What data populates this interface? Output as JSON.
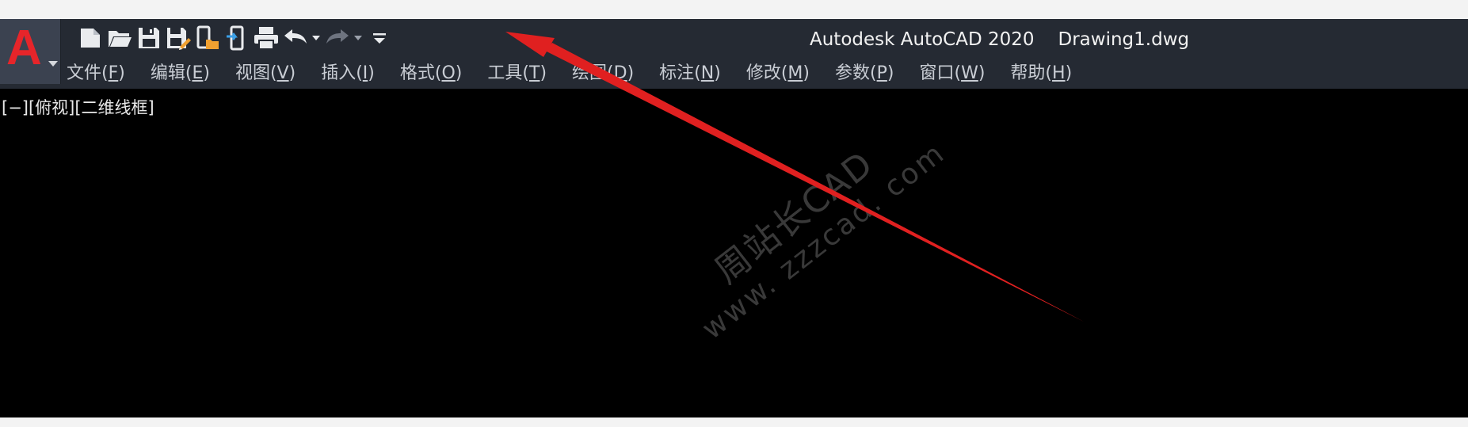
{
  "window": {
    "app_title": "Autodesk AutoCAD 2020",
    "document_title": "Drawing1.dwg",
    "app_logo": "A"
  },
  "quick_access_toolbar": [
    {
      "name": "new-file-icon"
    },
    {
      "name": "open-folder-icon"
    },
    {
      "name": "save-icon"
    },
    {
      "name": "save-as-icon"
    },
    {
      "name": "open-from-web-icon"
    },
    {
      "name": "save-to-web-icon"
    },
    {
      "name": "plot-print-icon"
    },
    {
      "name": "undo-icon"
    },
    {
      "name": "redo-icon"
    },
    {
      "name": "customize-toolbar-icon"
    }
  ],
  "menu": [
    {
      "label": "文件(",
      "key": "F",
      "end": ")"
    },
    {
      "label": "编辑(",
      "key": "E",
      "end": ")"
    },
    {
      "label": "视图(",
      "key": "V",
      "end": ")"
    },
    {
      "label": "插入(",
      "key": "I",
      "end": ")"
    },
    {
      "label": "格式(",
      "key": "O",
      "end": ")"
    },
    {
      "label": "工具(",
      "key": "T",
      "end": ")"
    },
    {
      "label": "绘图(",
      "key": "D",
      "end": ")"
    },
    {
      "label": "标注(",
      "key": "N",
      "end": ")"
    },
    {
      "label": "修改(",
      "key": "M",
      "end": ")"
    },
    {
      "label": "参数(",
      "key": "P",
      "end": ")"
    },
    {
      "label": "窗口(",
      "key": "W",
      "end": ")"
    },
    {
      "label": "帮助(",
      "key": "H",
      "end": ")"
    }
  ],
  "viewport": {
    "controls_label": "[−][俯视][二维线框]"
  },
  "watermark": {
    "line1": "周站长CAD",
    "line2": "www. zzzcad. com"
  },
  "colors": {
    "titlebar": "#252a33",
    "canvas": "#000000",
    "logo_red": "#e6252a",
    "annotation_arrow": "#e02020"
  }
}
